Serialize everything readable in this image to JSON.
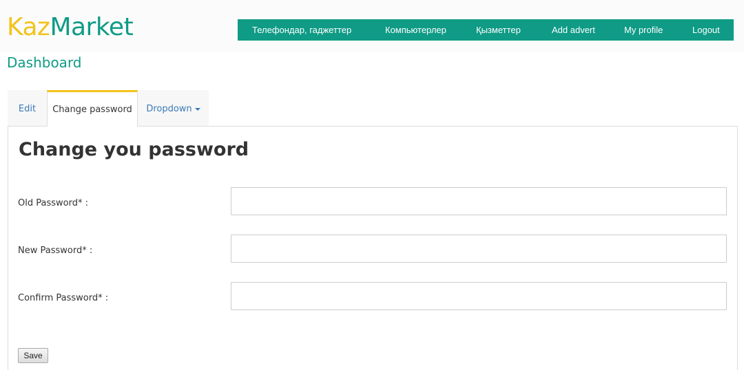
{
  "brand": {
    "part_a": "Kaz",
    "part_b": "Market"
  },
  "page_title": "Dashboard",
  "topnav": {
    "items": [
      "Телефондар, гаджеттер",
      "Компьютерлер",
      "Қызметтер",
      "Add advert",
      "My profile",
      "Logout"
    ]
  },
  "tabs": {
    "edit": "Edit",
    "change_password": "Change password",
    "dropdown": "Dropdown"
  },
  "form": {
    "heading": "Change you password",
    "old_password_label": "Old Password* :",
    "new_password_label": "New Password* :",
    "confirm_password_label": "Confirm Password* :",
    "old_password_value": "",
    "new_password_value": "",
    "confirm_password_value": "",
    "save_label": "Save"
  },
  "colors": {
    "brand_yellow": "#f3c31a",
    "brand_teal": "#0f9b86",
    "link_blue": "#3a7ab8"
  },
  "icons": {
    "dropdown_caret": "caret-down-icon"
  }
}
